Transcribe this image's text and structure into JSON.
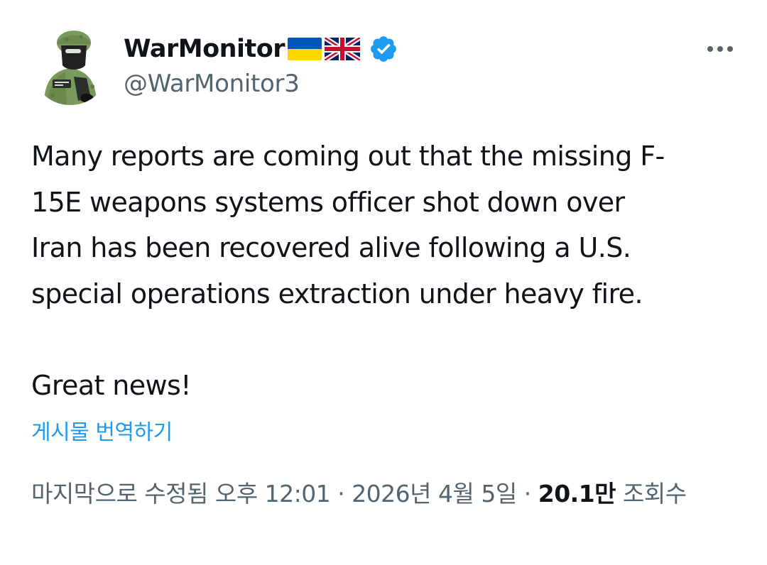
{
  "user": {
    "display_name": "WarMonitor",
    "handle": "@WarMonitor3",
    "flags": [
      "ukraine-flag",
      "united-kingdom-flag"
    ],
    "verified": true,
    "avatar": "soldier-avatar"
  },
  "more_icon": "more-horizontal-icon",
  "tweet": {
    "lines": [
      "Many reports are coming out that the missing F-",
      "15E weapons systems officer shot down over",
      "Iran has been recovered alive following a U.S.",
      "special operations extraction under heavy fire."
    ],
    "closing": "Great news!"
  },
  "translate_label": "게시물 번역하기",
  "meta": {
    "edited_label": "마지막으로 수정됨",
    "time": "오후 12:01",
    "separator": "·",
    "date": "2026년 4월 5일",
    "views_count": "20.1만",
    "views_label": "조회수"
  },
  "colors": {
    "text_primary": "#0f1419",
    "text_secondary": "#536471",
    "link": "#1d9bf0",
    "verified_badge": "#1d9bf0",
    "ukraine_blue": "#0057b7",
    "ukraine_yellow": "#ffd700",
    "uk_blue": "#012169",
    "uk_red": "#c8102e"
  }
}
